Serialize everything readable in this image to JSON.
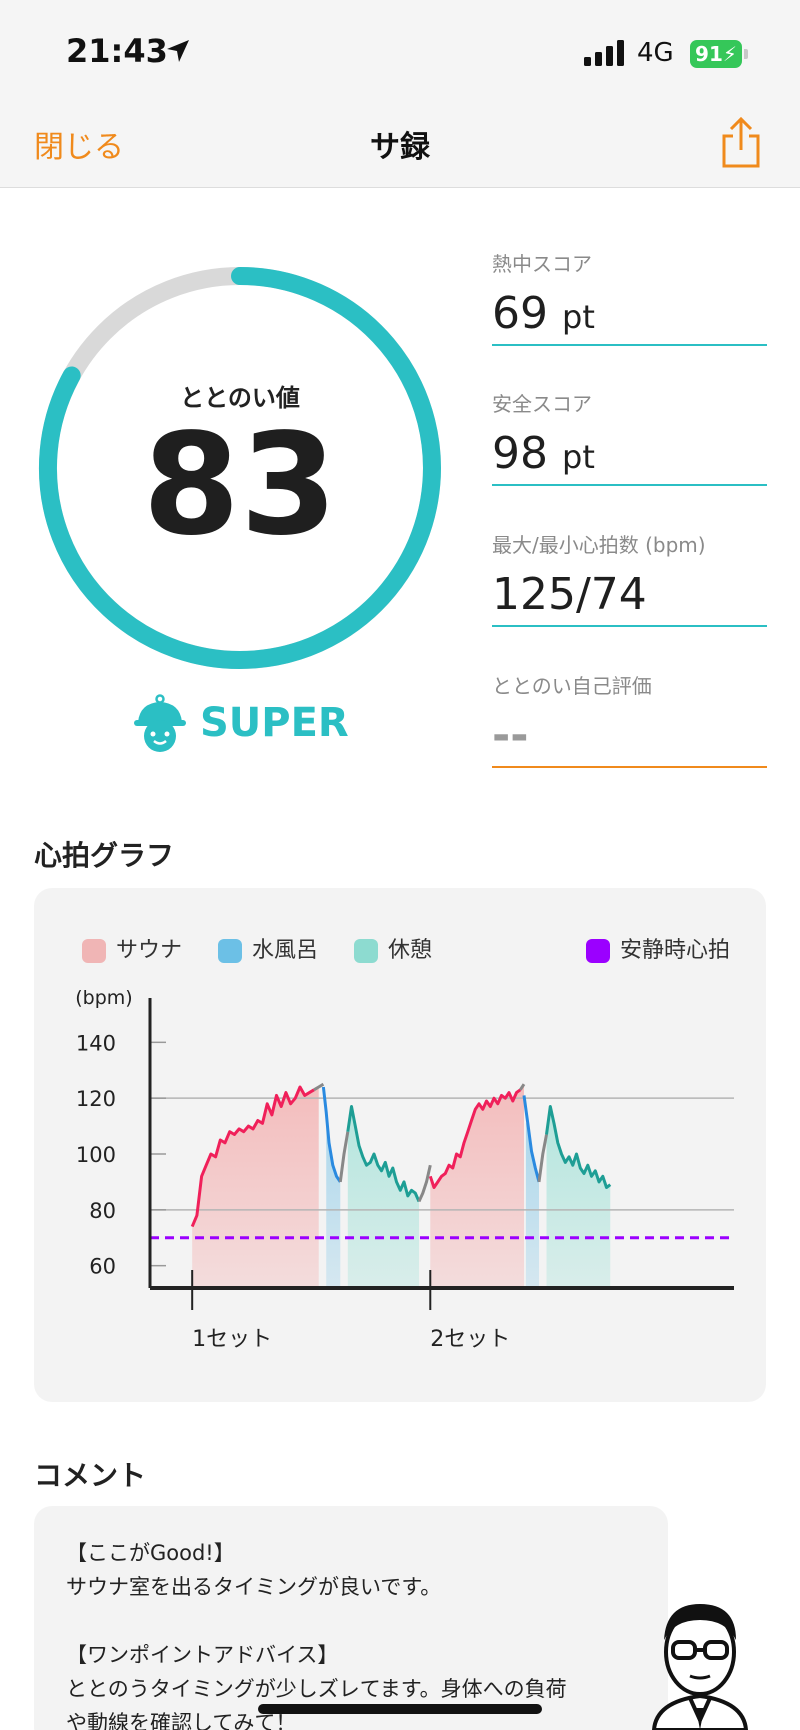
{
  "status": {
    "time": "21:43",
    "network": "4G",
    "battery": "91"
  },
  "nav": {
    "close_label": "閉じる",
    "title": "サ録"
  },
  "score_section": {
    "gauge_label": "ととのい値",
    "gauge_value": "83",
    "gauge_fraction": 0.83,
    "rank": "SUPER",
    "scores": [
      {
        "label": "熱中スコア",
        "value": "69",
        "unit": "pt"
      },
      {
        "label": "安全スコア",
        "value": "98",
        "unit": "pt"
      },
      {
        "label": "最大/最小心拍数 (bpm)",
        "value": "125/74"
      },
      {
        "label": "ととのい自己評価",
        "value": "--"
      }
    ]
  },
  "heart_graph": {
    "title": "心拍グラフ",
    "legend": [
      {
        "label": "サウナ",
        "color": "#f0a9a9"
      },
      {
        "label": "水風呂",
        "color": "#6cc0e6"
      },
      {
        "label": "休憩",
        "color": "#8ddbd0"
      },
      {
        "label": "安静時心拍",
        "color": "#9b00ff"
      }
    ],
    "chart_data": {
      "type": "line",
      "ylabel": "(bpm)",
      "yticks": [
        140,
        120,
        100,
        80,
        60
      ],
      "ylim": [
        52,
        148
      ],
      "x_labels": [
        "1セット",
        "2セット"
      ],
      "resting_hr": 70,
      "grid_lines": [
        120,
        80
      ],
      "segments": [
        {
          "phase": "sauna",
          "color": "#f0205a",
          "points": [
            [
              0,
              74
            ],
            [
              0.5,
              78
            ],
            [
              1,
              92
            ],
            [
              1.5,
              96
            ],
            [
              2,
              100
            ],
            [
              2.5,
              99
            ],
            [
              3,
              105
            ],
            [
              3.5,
              104
            ],
            [
              4,
              108
            ],
            [
              4.5,
              107
            ],
            [
              5,
              109
            ],
            [
              5.5,
              108
            ],
            [
              6,
              110
            ],
            [
              6.5,
              109
            ],
            [
              7,
              112
            ],
            [
              7.5,
              111
            ],
            [
              8,
              118
            ],
            [
              8.5,
              114
            ],
            [
              9,
              121
            ],
            [
              9.5,
              117
            ],
            [
              10,
              122
            ],
            [
              10.5,
              118
            ],
            [
              11,
              120
            ],
            [
              11.5,
              124
            ],
            [
              12,
              121
            ],
            [
              12.5,
              122
            ],
            [
              13,
              123
            ]
          ]
        },
        {
          "phase": "sauna-transition",
          "color": "#888888",
          "points": [
            [
              13,
              123
            ],
            [
              13.5,
              124
            ],
            [
              14,
              125
            ]
          ]
        },
        {
          "phase": "cold-bath",
          "color": "#2a8ae0",
          "points": [
            [
              14,
              124
            ],
            [
              14.3,
              115
            ],
            [
              14.6,
              104
            ],
            [
              15,
              96
            ],
            [
              15.4,
              92
            ],
            [
              15.8,
              90
            ]
          ]
        },
        {
          "phase": "transition",
          "color": "#888888",
          "points": [
            [
              15.8,
              90
            ],
            [
              16.2,
              100
            ],
            [
              16.6,
              108
            ]
          ]
        },
        {
          "phase": "rest",
          "color": "#1e9e95",
          "points": [
            [
              16.6,
              108
            ],
            [
              17,
              117
            ],
            [
              17.4,
              110
            ],
            [
              17.8,
              103
            ],
            [
              18.2,
              99
            ],
            [
              18.6,
              96
            ],
            [
              19,
              97
            ],
            [
              19.4,
              100
            ],
            [
              19.8,
              96
            ],
            [
              20.2,
              94
            ],
            [
              20.6,
              97
            ],
            [
              21,
              92
            ],
            [
              21.4,
              95
            ],
            [
              21.8,
              90
            ],
            [
              22.2,
              87
            ],
            [
              22.6,
              90
            ],
            [
              23,
              85
            ],
            [
              23.4,
              87
            ],
            [
              23.8,
              86
            ],
            [
              24.2,
              83
            ]
          ]
        },
        {
          "phase": "transition",
          "color": "#888888",
          "points": [
            [
              24.2,
              83
            ],
            [
              24.6,
              86
            ],
            [
              25,
              90
            ],
            [
              25.4,
              96
            ]
          ]
        },
        {
          "phase": "sauna",
          "color": "#f0205a",
          "points": [
            [
              25.4,
              92
            ],
            [
              25.8,
              88
            ],
            [
              26.2,
              90
            ],
            [
              26.6,
              92
            ],
            [
              27,
              93
            ],
            [
              27.4,
              96
            ],
            [
              27.8,
              95
            ],
            [
              28.2,
              100
            ],
            [
              28.6,
              99
            ],
            [
              29,
              104
            ],
            [
              29.4,
              108
            ],
            [
              29.8,
              112
            ],
            [
              30.2,
              116
            ],
            [
              30.6,
              118
            ],
            [
              31,
              116
            ],
            [
              31.4,
              119
            ],
            [
              31.8,
              117
            ],
            [
              32.2,
              120
            ],
            [
              32.6,
              118
            ],
            [
              33,
              121
            ],
            [
              33.4,
              120
            ],
            [
              33.8,
              122
            ],
            [
              34.2,
              119
            ],
            [
              34.6,
              122
            ],
            [
              35,
              123
            ]
          ]
        },
        {
          "phase": "sauna-transition",
          "color": "#888888",
          "points": [
            [
              35,
              123
            ],
            [
              35.4,
              125
            ]
          ]
        },
        {
          "phase": "cold-bath",
          "color": "#2a8ae0",
          "points": [
            [
              35.4,
              121
            ],
            [
              35.8,
              111
            ],
            [
              36.2,
              101
            ],
            [
              36.6,
              95
            ],
            [
              37,
              90
            ]
          ]
        },
        {
          "phase": "transition",
          "color": "#888888",
          "points": [
            [
              37,
              90
            ],
            [
              37.4,
              100
            ],
            [
              37.8,
              107
            ]
          ]
        },
        {
          "phase": "rest",
          "color": "#1e9e95",
          "points": [
            [
              37.8,
              107
            ],
            [
              38.2,
              117
            ],
            [
              38.6,
              111
            ],
            [
              39,
              104
            ],
            [
              39.4,
              100
            ],
            [
              39.8,
              97
            ],
            [
              40.2,
              99
            ],
            [
              40.6,
              96
            ],
            [
              41,
              100
            ],
            [
              41.4,
              95
            ],
            [
              41.8,
              93
            ],
            [
              42.2,
              96
            ],
            [
              42.6,
              92
            ],
            [
              43,
              94
            ],
            [
              43.4,
              90
            ],
            [
              43.8,
              92
            ],
            [
              44.2,
              88
            ],
            [
              44.6,
              89
            ]
          ]
        }
      ],
      "bands": [
        {
          "phase": "sauna",
          "from": 0,
          "to": 13.5
        },
        {
          "phase": "cold-bath",
          "from": 14.3,
          "to": 15.8
        },
        {
          "phase": "rest",
          "from": 16.6,
          "to": 24.2
        },
        {
          "phase": "sauna",
          "from": 25.4,
          "to": 35.4
        },
        {
          "phase": "cold-bath",
          "from": 35.6,
          "to": 37
        },
        {
          "phase": "rest",
          "from": 37.8,
          "to": 44.6
        }
      ],
      "xlim": [
        -4.5,
        57.8
      ],
      "set_ticks": [
        0,
        25.4
      ]
    }
  },
  "comment": {
    "title": "コメント",
    "lines": [
      "【ここがGood!】",
      "サウナ室を出るタイミングが良いです。",
      "",
      "【ワンポイントアドバイス】",
      "ととのうタイミングが少しズレてます。身体への負荷",
      "や動線を確認してみて！"
    ]
  },
  "colors": {
    "accent": "#f08a1c",
    "teal": "#2bbfc4"
  },
  "icons": {
    "location": "location-arrow-icon",
    "share": "share-icon",
    "mascot": "sauna-mascot-icon",
    "doctor": "doctor-avatar"
  }
}
